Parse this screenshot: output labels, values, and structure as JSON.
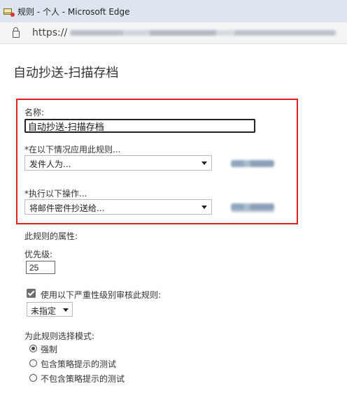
{
  "window": {
    "title": "规则 - 个人 - Microsoft Edge"
  },
  "address": {
    "url_prefix": "https://"
  },
  "page": {
    "title": "自动抄送-扫描存档"
  },
  "name_field": {
    "label": "名称:",
    "value": "自动抄送-扫描存档"
  },
  "condition": {
    "label": "*在以下情况应用此规则...",
    "selected": "发件人为..."
  },
  "action": {
    "label": "*执行以下操作...",
    "selected": "将邮件密件抄送给..."
  },
  "properties": {
    "heading": "此规则的属性:"
  },
  "priority": {
    "label": "优先级:",
    "value": "25"
  },
  "severity": {
    "checkbox_label": "使用以下严重性级别审核此规则:",
    "checked": true,
    "selected": "未指定"
  },
  "mode": {
    "heading": "为此规则选择模式:",
    "options": [
      "强制",
      "包含策略提示的测试",
      "不包含策略提示的测试"
    ],
    "selected_index": 0
  }
}
